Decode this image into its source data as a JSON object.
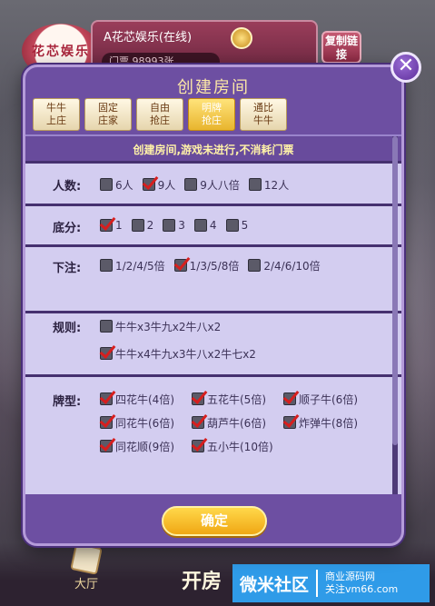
{
  "lobby": {
    "logo_text": "花芯娱乐",
    "title": "A花芯娱乐(在线)",
    "ticket": "门票 98993张",
    "copy_button": "复制链接",
    "hall_label": "大厅",
    "open_room_label": "开房"
  },
  "watermark": {
    "main": "微米社区",
    "line1": "商业源码网",
    "line2": "关注vm66.com"
  },
  "modal": {
    "title": "创建房间",
    "close_glyph": "✕",
    "tabs": [
      {
        "line1": "牛牛",
        "line2": "上庄",
        "active": false
      },
      {
        "line1": "固定",
        "line2": "庄家",
        "active": false
      },
      {
        "line1": "自由",
        "line2": "抢庄",
        "active": false
      },
      {
        "line1": "明牌",
        "line2": "抢庄",
        "active": true
      },
      {
        "line1": "通比",
        "line2": "牛牛",
        "active": false
      }
    ],
    "notice": "创建房间,游戏未进行,不消耗门票",
    "players": {
      "label": "人数:",
      "options": [
        "6人",
        "9人",
        "9人八倍",
        "12人"
      ],
      "checked": [
        false,
        true,
        false,
        false
      ]
    },
    "base": {
      "label": "底分:",
      "options": [
        "1",
        "2",
        "3",
        "4",
        "5"
      ],
      "checked": [
        true,
        false,
        false,
        false,
        false
      ]
    },
    "bet": {
      "label": "下注:",
      "options": [
        "1/2/4/5倍",
        "1/3/5/8倍",
        "2/4/6/10倍"
      ],
      "checked": [
        false,
        true,
        false
      ]
    },
    "rules": {
      "label": "规则:",
      "options": [
        "牛牛x3牛九x2牛八x2",
        "牛牛x4牛九x3牛八x2牛七x2"
      ],
      "checked": [
        false,
        true
      ]
    },
    "cardtypes": {
      "label": "牌型:",
      "options": [
        "四花牛(4倍)",
        "五花牛(5倍)",
        "顺子牛(6倍)",
        "同花牛(6倍)",
        "葫芦牛(6倍)",
        "炸弹牛(8倍)",
        "同花顺(9倍)",
        "五小牛(10倍)"
      ],
      "checked": [
        true,
        true,
        true,
        true,
        true,
        true,
        true,
        true
      ]
    },
    "confirm_label": "确定"
  },
  "colors": {
    "modal_bg": "#6d4fa2",
    "panel_bg": "#d3cdf0",
    "notice_text": "#fff2a8",
    "check_mark": "#d71e1e",
    "confirm_button": "#f0a714"
  }
}
